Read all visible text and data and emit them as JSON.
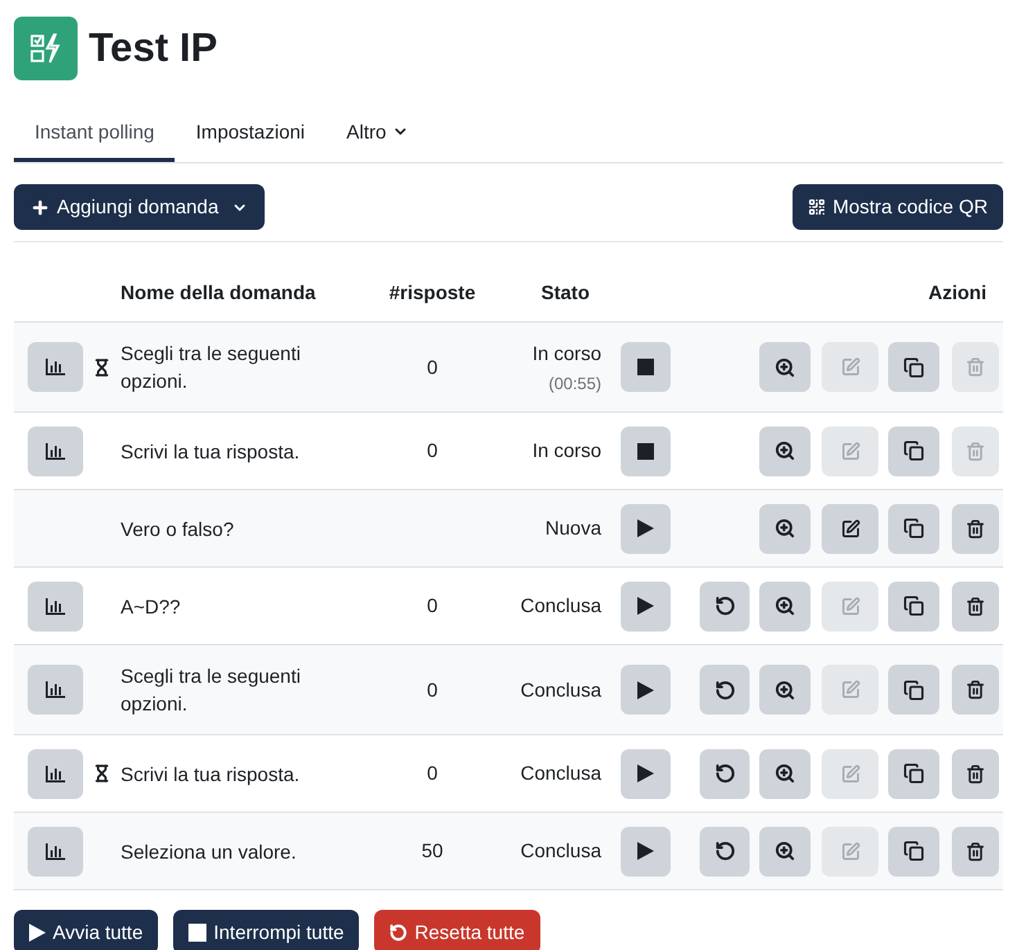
{
  "header": {
    "title": "Test IP"
  },
  "tabs": [
    {
      "label": "Instant polling",
      "selected": true,
      "dropdown": false
    },
    {
      "label": "Impostazioni",
      "selected": false,
      "dropdown": false
    },
    {
      "label": "Altro",
      "selected": false,
      "dropdown": true
    }
  ],
  "toolbar": {
    "add_button": "Aggiungi domanda",
    "qr_button": "Mostra codice QR"
  },
  "table": {
    "columns": [
      "Nome della domanda",
      "#risposte",
      "Stato",
      "Azioni"
    ],
    "rows": [
      {
        "name": "Scegli tra le seguenti opzioni.",
        "responses": "0",
        "status": "In corso",
        "timer": "(00:55)",
        "has_stats": true,
        "timed": true,
        "running": true,
        "can_reset": false,
        "edit_disabled": true,
        "delete_disabled": true
      },
      {
        "name": "Scrivi la tua risposta.",
        "responses": "0",
        "status": "In corso",
        "has_stats": true,
        "timed": false,
        "running": true,
        "can_reset": false,
        "edit_disabled": true,
        "delete_disabled": true
      },
      {
        "name": "Vero o falso?",
        "status": "Nuova",
        "has_stats": false,
        "timed": false,
        "running": false,
        "can_reset": false,
        "edit_disabled": false,
        "delete_disabled": false
      },
      {
        "name": "A~D??",
        "responses": "0",
        "status": "Conclusa",
        "has_stats": true,
        "timed": false,
        "running": false,
        "can_reset": true,
        "edit_disabled": true,
        "delete_disabled": false
      },
      {
        "name": "Scegli tra le seguenti opzioni.",
        "responses": "0",
        "status": "Conclusa",
        "has_stats": true,
        "timed": false,
        "running": false,
        "can_reset": true,
        "edit_disabled": true,
        "delete_disabled": false
      },
      {
        "name": "Scrivi la tua risposta.",
        "responses": "0",
        "status": "Conclusa",
        "has_stats": true,
        "timed": true,
        "running": false,
        "can_reset": true,
        "edit_disabled": true,
        "delete_disabled": false
      },
      {
        "name": "Seleziona un valore.",
        "responses": "50",
        "status": "Conclusa",
        "has_stats": true,
        "timed": false,
        "running": false,
        "can_reset": true,
        "edit_disabled": true,
        "delete_disabled": false
      }
    ]
  },
  "footer_buttons": [
    {
      "label": "Avvia tutte",
      "kind": "start"
    },
    {
      "label": "Interrompi tutte",
      "kind": "stop"
    },
    {
      "label": "Resetta tutte",
      "kind": "reset"
    }
  ]
}
